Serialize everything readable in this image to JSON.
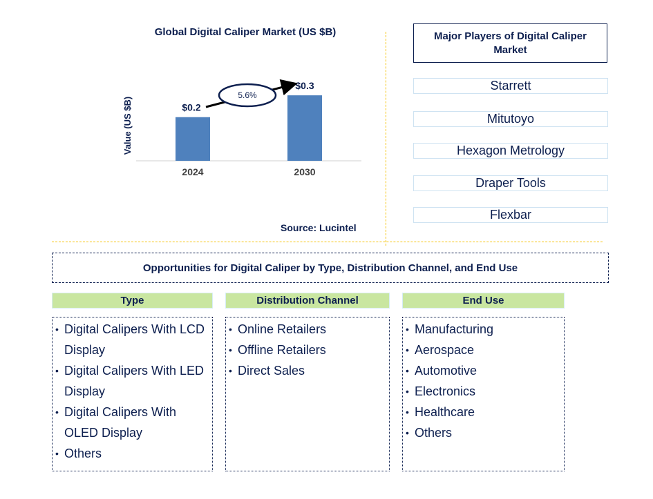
{
  "chart_data": {
    "type": "bar",
    "title": "Global Digital Caliper Market (US $B)",
    "xlabel": "",
    "ylabel": "Value (US $B)",
    "categories": [
      "2024",
      "2030"
    ],
    "values": [
      0.2,
      0.3
    ],
    "data_labels": [
      "$0.2",
      "$0.3"
    ],
    "ylim": [
      0,
      0.35
    ],
    "grid": false,
    "bar_color": "#4f81bd",
    "annotation": {
      "type": "cagr-arrow",
      "label": "5.6%",
      "from": "2024",
      "to": "2030"
    },
    "source": "Source: Lucintel"
  },
  "players": {
    "title": "Major Players of Digital Caliper Market",
    "items": [
      "Starrett",
      "Mitutoyo",
      "Hexagon Metrology",
      "Draper Tools",
      "Flexbar"
    ]
  },
  "opportunities": {
    "title": "Opportunities for Digital Caliper by Type, Distribution Channel, and End Use",
    "columns": [
      {
        "header": "Type",
        "items": [
          "Digital Calipers With LCD Display",
          "Digital Calipers With LED Display",
          "Digital Calipers With OLED Display",
          "Others"
        ]
      },
      {
        "header": "Distribution Channel",
        "items": [
          "Online Retailers",
          "Offline Retailers",
          "Direct Sales"
        ]
      },
      {
        "header": "End Use",
        "items": [
          "Manufacturing",
          "Aerospace",
          "Automotive",
          "Electronics",
          "Healthcare",
          "Others"
        ]
      }
    ]
  },
  "colors": {
    "text_dark": "#0d1f4f",
    "header_green": "#c9e6a0",
    "divider_yellow": "#f5c200",
    "player_border": "#cfe3f2"
  }
}
